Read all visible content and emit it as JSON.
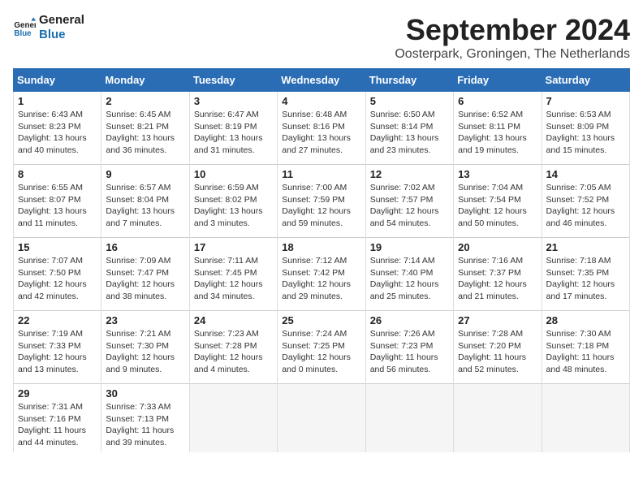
{
  "logo": {
    "line1": "General",
    "line2": "Blue"
  },
  "title": "September 2024",
  "location": "Oosterpark, Groningen, The Netherlands",
  "days_header": [
    "Sunday",
    "Monday",
    "Tuesday",
    "Wednesday",
    "Thursday",
    "Friday",
    "Saturday"
  ],
  "weeks": [
    [
      {
        "day": "1",
        "info": "Sunrise: 6:43 AM\nSunset: 8:23 PM\nDaylight: 13 hours\nand 40 minutes."
      },
      {
        "day": "2",
        "info": "Sunrise: 6:45 AM\nSunset: 8:21 PM\nDaylight: 13 hours\nand 36 minutes."
      },
      {
        "day": "3",
        "info": "Sunrise: 6:47 AM\nSunset: 8:19 PM\nDaylight: 13 hours\nand 31 minutes."
      },
      {
        "day": "4",
        "info": "Sunrise: 6:48 AM\nSunset: 8:16 PM\nDaylight: 13 hours\nand 27 minutes."
      },
      {
        "day": "5",
        "info": "Sunrise: 6:50 AM\nSunset: 8:14 PM\nDaylight: 13 hours\nand 23 minutes."
      },
      {
        "day": "6",
        "info": "Sunrise: 6:52 AM\nSunset: 8:11 PM\nDaylight: 13 hours\nand 19 minutes."
      },
      {
        "day": "7",
        "info": "Sunrise: 6:53 AM\nSunset: 8:09 PM\nDaylight: 13 hours\nand 15 minutes."
      }
    ],
    [
      {
        "day": "8",
        "info": "Sunrise: 6:55 AM\nSunset: 8:07 PM\nDaylight: 13 hours\nand 11 minutes."
      },
      {
        "day": "9",
        "info": "Sunrise: 6:57 AM\nSunset: 8:04 PM\nDaylight: 13 hours\nand 7 minutes."
      },
      {
        "day": "10",
        "info": "Sunrise: 6:59 AM\nSunset: 8:02 PM\nDaylight: 13 hours\nand 3 minutes."
      },
      {
        "day": "11",
        "info": "Sunrise: 7:00 AM\nSunset: 7:59 PM\nDaylight: 12 hours\nand 59 minutes."
      },
      {
        "day": "12",
        "info": "Sunrise: 7:02 AM\nSunset: 7:57 PM\nDaylight: 12 hours\nand 54 minutes."
      },
      {
        "day": "13",
        "info": "Sunrise: 7:04 AM\nSunset: 7:54 PM\nDaylight: 12 hours\nand 50 minutes."
      },
      {
        "day": "14",
        "info": "Sunrise: 7:05 AM\nSunset: 7:52 PM\nDaylight: 12 hours\nand 46 minutes."
      }
    ],
    [
      {
        "day": "15",
        "info": "Sunrise: 7:07 AM\nSunset: 7:50 PM\nDaylight: 12 hours\nand 42 minutes."
      },
      {
        "day": "16",
        "info": "Sunrise: 7:09 AM\nSunset: 7:47 PM\nDaylight: 12 hours\nand 38 minutes."
      },
      {
        "day": "17",
        "info": "Sunrise: 7:11 AM\nSunset: 7:45 PM\nDaylight: 12 hours\nand 34 minutes."
      },
      {
        "day": "18",
        "info": "Sunrise: 7:12 AM\nSunset: 7:42 PM\nDaylight: 12 hours\nand 29 minutes."
      },
      {
        "day": "19",
        "info": "Sunrise: 7:14 AM\nSunset: 7:40 PM\nDaylight: 12 hours\nand 25 minutes."
      },
      {
        "day": "20",
        "info": "Sunrise: 7:16 AM\nSunset: 7:37 PM\nDaylight: 12 hours\nand 21 minutes."
      },
      {
        "day": "21",
        "info": "Sunrise: 7:18 AM\nSunset: 7:35 PM\nDaylight: 12 hours\nand 17 minutes."
      }
    ],
    [
      {
        "day": "22",
        "info": "Sunrise: 7:19 AM\nSunset: 7:33 PM\nDaylight: 12 hours\nand 13 minutes."
      },
      {
        "day": "23",
        "info": "Sunrise: 7:21 AM\nSunset: 7:30 PM\nDaylight: 12 hours\nand 9 minutes."
      },
      {
        "day": "24",
        "info": "Sunrise: 7:23 AM\nSunset: 7:28 PM\nDaylight: 12 hours\nand 4 minutes."
      },
      {
        "day": "25",
        "info": "Sunrise: 7:24 AM\nSunset: 7:25 PM\nDaylight: 12 hours\nand 0 minutes."
      },
      {
        "day": "26",
        "info": "Sunrise: 7:26 AM\nSunset: 7:23 PM\nDaylight: 11 hours\nand 56 minutes."
      },
      {
        "day": "27",
        "info": "Sunrise: 7:28 AM\nSunset: 7:20 PM\nDaylight: 11 hours\nand 52 minutes."
      },
      {
        "day": "28",
        "info": "Sunrise: 7:30 AM\nSunset: 7:18 PM\nDaylight: 11 hours\nand 48 minutes."
      }
    ],
    [
      {
        "day": "29",
        "info": "Sunrise: 7:31 AM\nSunset: 7:16 PM\nDaylight: 11 hours\nand 44 minutes."
      },
      {
        "day": "30",
        "info": "Sunrise: 7:33 AM\nSunset: 7:13 PM\nDaylight: 11 hours\nand 39 minutes."
      },
      {
        "day": "",
        "info": ""
      },
      {
        "day": "",
        "info": ""
      },
      {
        "day": "",
        "info": ""
      },
      {
        "day": "",
        "info": ""
      },
      {
        "day": "",
        "info": ""
      }
    ]
  ]
}
